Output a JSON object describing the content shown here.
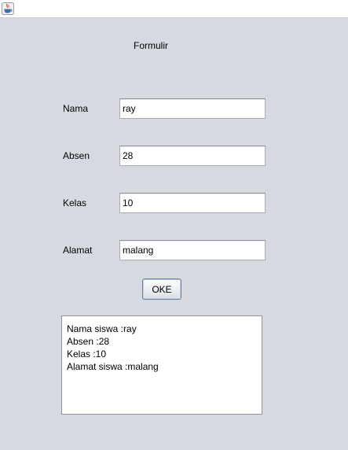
{
  "window": {
    "icon": "java-coffee-cup-icon"
  },
  "form": {
    "title": "Formulir",
    "fields": [
      {
        "label": "Nama",
        "value": "ray"
      },
      {
        "label": "Absen",
        "value": "28"
      },
      {
        "label": "Kelas",
        "value": "10"
      },
      {
        "label": "Alamat",
        "value": "malang"
      }
    ],
    "ok_label": "OKE"
  },
  "output": {
    "lines": [
      "Nama siswa :ray",
      "Absen :28",
      "Kelas :10",
      "Alamat siswa :malang"
    ]
  }
}
